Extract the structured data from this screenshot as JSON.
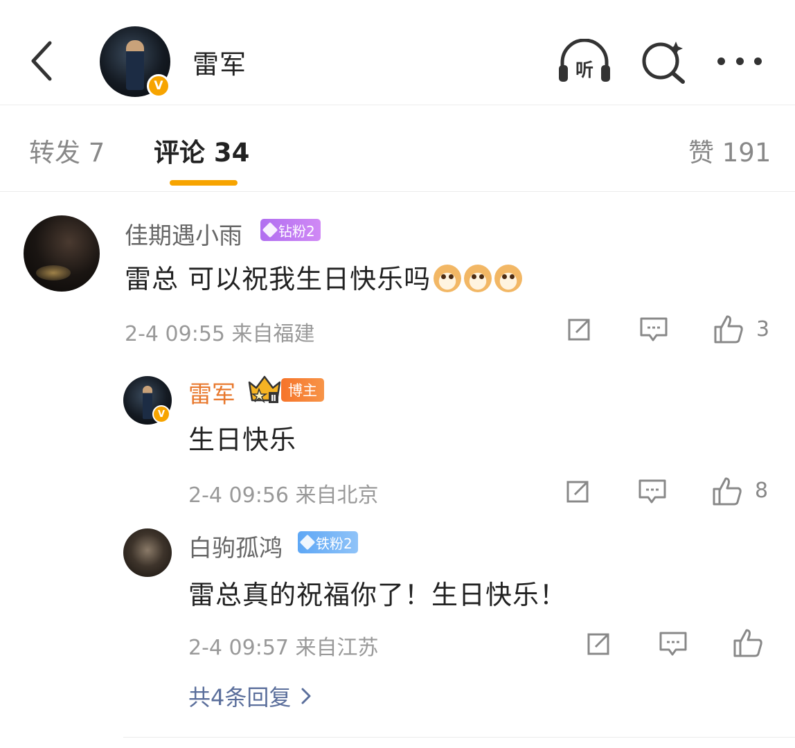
{
  "header": {
    "title": "雷军",
    "listen_label": "听"
  },
  "tabs": [
    {
      "label": "转发 7"
    },
    {
      "label": "评论 34"
    },
    {
      "label": "赞 191"
    }
  ],
  "comments": [
    {
      "user": "佳期遇小雨",
      "badge": "钻粉2",
      "text": "雷总 可以祝我生日快乐吗",
      "time_location": "2-4 09:55 来自福建",
      "likes": "3"
    }
  ],
  "replies": [
    {
      "user": "雷军",
      "badge": "博主",
      "crown_level": "Ⅱ",
      "text": "生日快乐",
      "time_location": "2-4 09:56 来自北京",
      "likes": "8"
    },
    {
      "user": "白驹孤鸿",
      "badge": "铁粉2",
      "text": "雷总真的祝福你了！生日快乐！",
      "time_location": "2-4 09:57 来自江苏",
      "likes": ""
    }
  ],
  "more_replies": "共4条回复",
  "colors": {
    "accent": "#f7a400",
    "host_name": "#e8782d",
    "link": "#5a6e9b",
    "diamond_badge": "#b06ef0",
    "iron_badge": "#5ea7f5"
  }
}
